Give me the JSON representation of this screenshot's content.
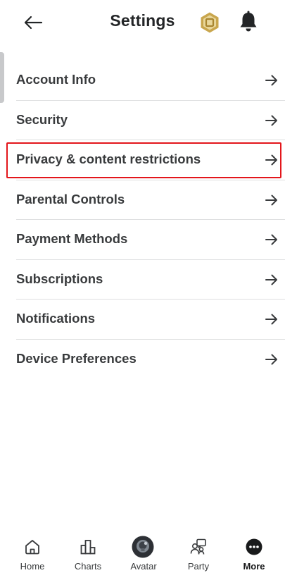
{
  "header": {
    "title": "Settings"
  },
  "menu": {
    "items": [
      {
        "label": "Account Info"
      },
      {
        "label": "Security"
      },
      {
        "label": "Privacy & content restrictions"
      },
      {
        "label": "Parental Controls"
      },
      {
        "label": "Payment Methods"
      },
      {
        "label": "Subscriptions"
      },
      {
        "label": "Notifications"
      },
      {
        "label": "Device Preferences"
      }
    ],
    "highlighted_item": "Privacy & content restrictions",
    "highlight_color": "#e3161b"
  },
  "nav": {
    "items": [
      {
        "label": "Home",
        "icon": "home-icon"
      },
      {
        "label": "Charts",
        "icon": "charts-icon"
      },
      {
        "label": "Avatar",
        "icon": "avatar-icon"
      },
      {
        "label": "Party",
        "icon": "party-icon"
      },
      {
        "label": "More",
        "icon": "more-icon",
        "active": true
      }
    ]
  },
  "colors": {
    "text": "#393b3d",
    "divider": "#dedfe0",
    "robux_gold": "#c9a64d"
  }
}
